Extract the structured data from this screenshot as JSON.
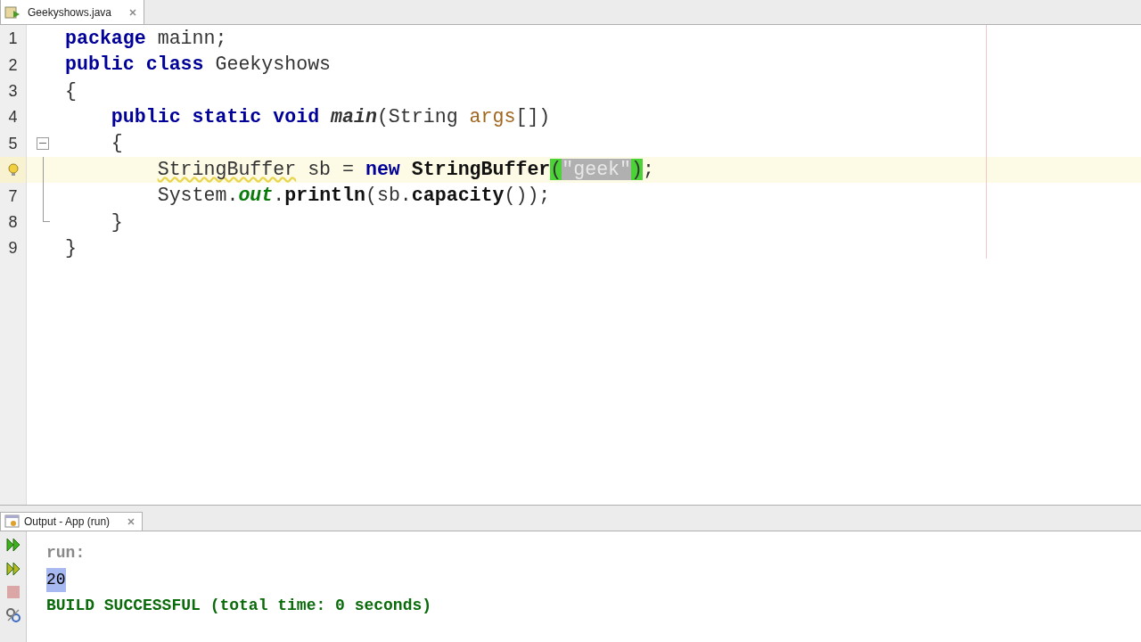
{
  "editor_tab": {
    "title": "Geekyshows.java",
    "selected": true
  },
  "code_lines": [
    {
      "number": "1",
      "current": false,
      "hint": false,
      "fold_start": false,
      "fold_inside": false,
      "fold_end": false,
      "tokens": [
        {
          "kind": "keyword",
          "text": "package"
        },
        {
          "kind": "plain",
          "text": " mainn;"
        }
      ]
    },
    {
      "number": "2",
      "current": false,
      "hint": false,
      "fold_start": false,
      "fold_inside": false,
      "fold_end": false,
      "tokens": [
        {
          "kind": "keyword",
          "text": "public class"
        },
        {
          "kind": "plain",
          "text": " Geekyshows"
        }
      ]
    },
    {
      "number": "3",
      "current": false,
      "hint": false,
      "fold_start": false,
      "fold_inside": false,
      "fold_end": false,
      "tokens": [
        {
          "kind": "plain",
          "text": "{"
        }
      ]
    },
    {
      "number": "4",
      "current": false,
      "hint": false,
      "fold_start": false,
      "fold_inside": false,
      "fold_end": false,
      "tokens": [
        {
          "kind": "keyword",
          "text": "    public static void "
        },
        {
          "kind": "method",
          "text": "main"
        },
        {
          "kind": "plain",
          "text": "(String "
        },
        {
          "kind": "param",
          "text": "args"
        },
        {
          "kind": "plain",
          "text": "[])"
        }
      ]
    },
    {
      "number": "5",
      "current": false,
      "hint": false,
      "fold_start": true,
      "fold_inside": false,
      "fold_end": false,
      "tokens": [
        {
          "kind": "plain",
          "text": "    {"
        }
      ]
    },
    {
      "current": true,
      "hint": true,
      "fold_start": false,
      "fold_inside": true,
      "fold_end": false,
      "tokens": [
        {
          "kind": "warning",
          "text": "        StringBuffer"
        },
        {
          "kind": "plain",
          "text": " sb = "
        },
        {
          "kind": "keyword",
          "text": "new "
        },
        {
          "kind": "call",
          "text": "StringBuffer"
        },
        {
          "kind": "match",
          "text": "("
        },
        {
          "kind": "string",
          "text": "\"geek\""
        },
        {
          "kind": "match",
          "text": ")"
        },
        {
          "kind": "plain",
          "text": ";"
        }
      ]
    },
    {
      "number": "7",
      "current": false,
      "hint": false,
      "fold_start": false,
      "fold_inside": true,
      "fold_end": false,
      "tokens": [
        {
          "kind": "plain",
          "text": "        System."
        },
        {
          "kind": "field",
          "text": "out"
        },
        {
          "kind": "plain",
          "text": "."
        },
        {
          "kind": "call",
          "text": "println"
        },
        {
          "kind": "plain",
          "text": "(sb."
        },
        {
          "kind": "call",
          "text": "capacity"
        },
        {
          "kind": "plain",
          "text": "());"
        }
      ]
    },
    {
      "number": "8",
      "current": false,
      "hint": false,
      "fold_start": false,
      "fold_inside": false,
      "fold_end": true,
      "tokens": [
        {
          "kind": "plain",
          "text": "    }"
        }
      ]
    },
    {
      "number": "9",
      "current": false,
      "hint": false,
      "fold_start": false,
      "fold_inside": false,
      "fold_end": false,
      "tokens": [
        {
          "kind": "plain",
          "text": "}"
        }
      ]
    }
  ],
  "output_tab": {
    "title": "Output - App (run)",
    "selected": true
  },
  "output_tools": [
    {
      "kind": "rerun",
      "disabled": false
    },
    {
      "kind": "rerun-alt",
      "disabled": false
    },
    {
      "kind": "stop",
      "disabled": true
    },
    {
      "kind": "settings",
      "disabled": false
    }
  ],
  "output_lines": [
    {
      "kind": "muted",
      "text": "run:"
    },
    {
      "kind": "selected",
      "text": "20"
    },
    {
      "kind": "success",
      "text": "BUILD SUCCESSFUL (total time: 0 seconds)"
    }
  ]
}
